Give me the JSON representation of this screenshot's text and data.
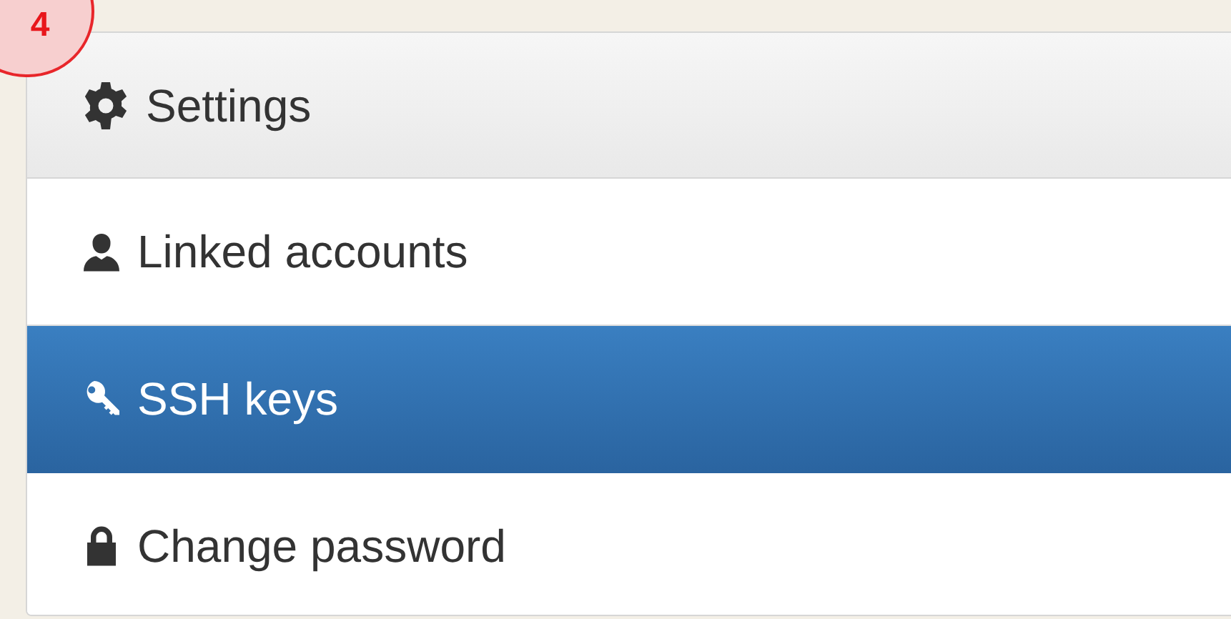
{
  "step_badge": "4",
  "panel": {
    "heading": "Settings",
    "items": [
      {
        "kind": "user",
        "label": "Linked accounts",
        "selected": false
      },
      {
        "kind": "key",
        "label": "SSH keys",
        "selected": true
      },
      {
        "kind": "lock",
        "label": "Change password",
        "selected": false
      }
    ]
  }
}
